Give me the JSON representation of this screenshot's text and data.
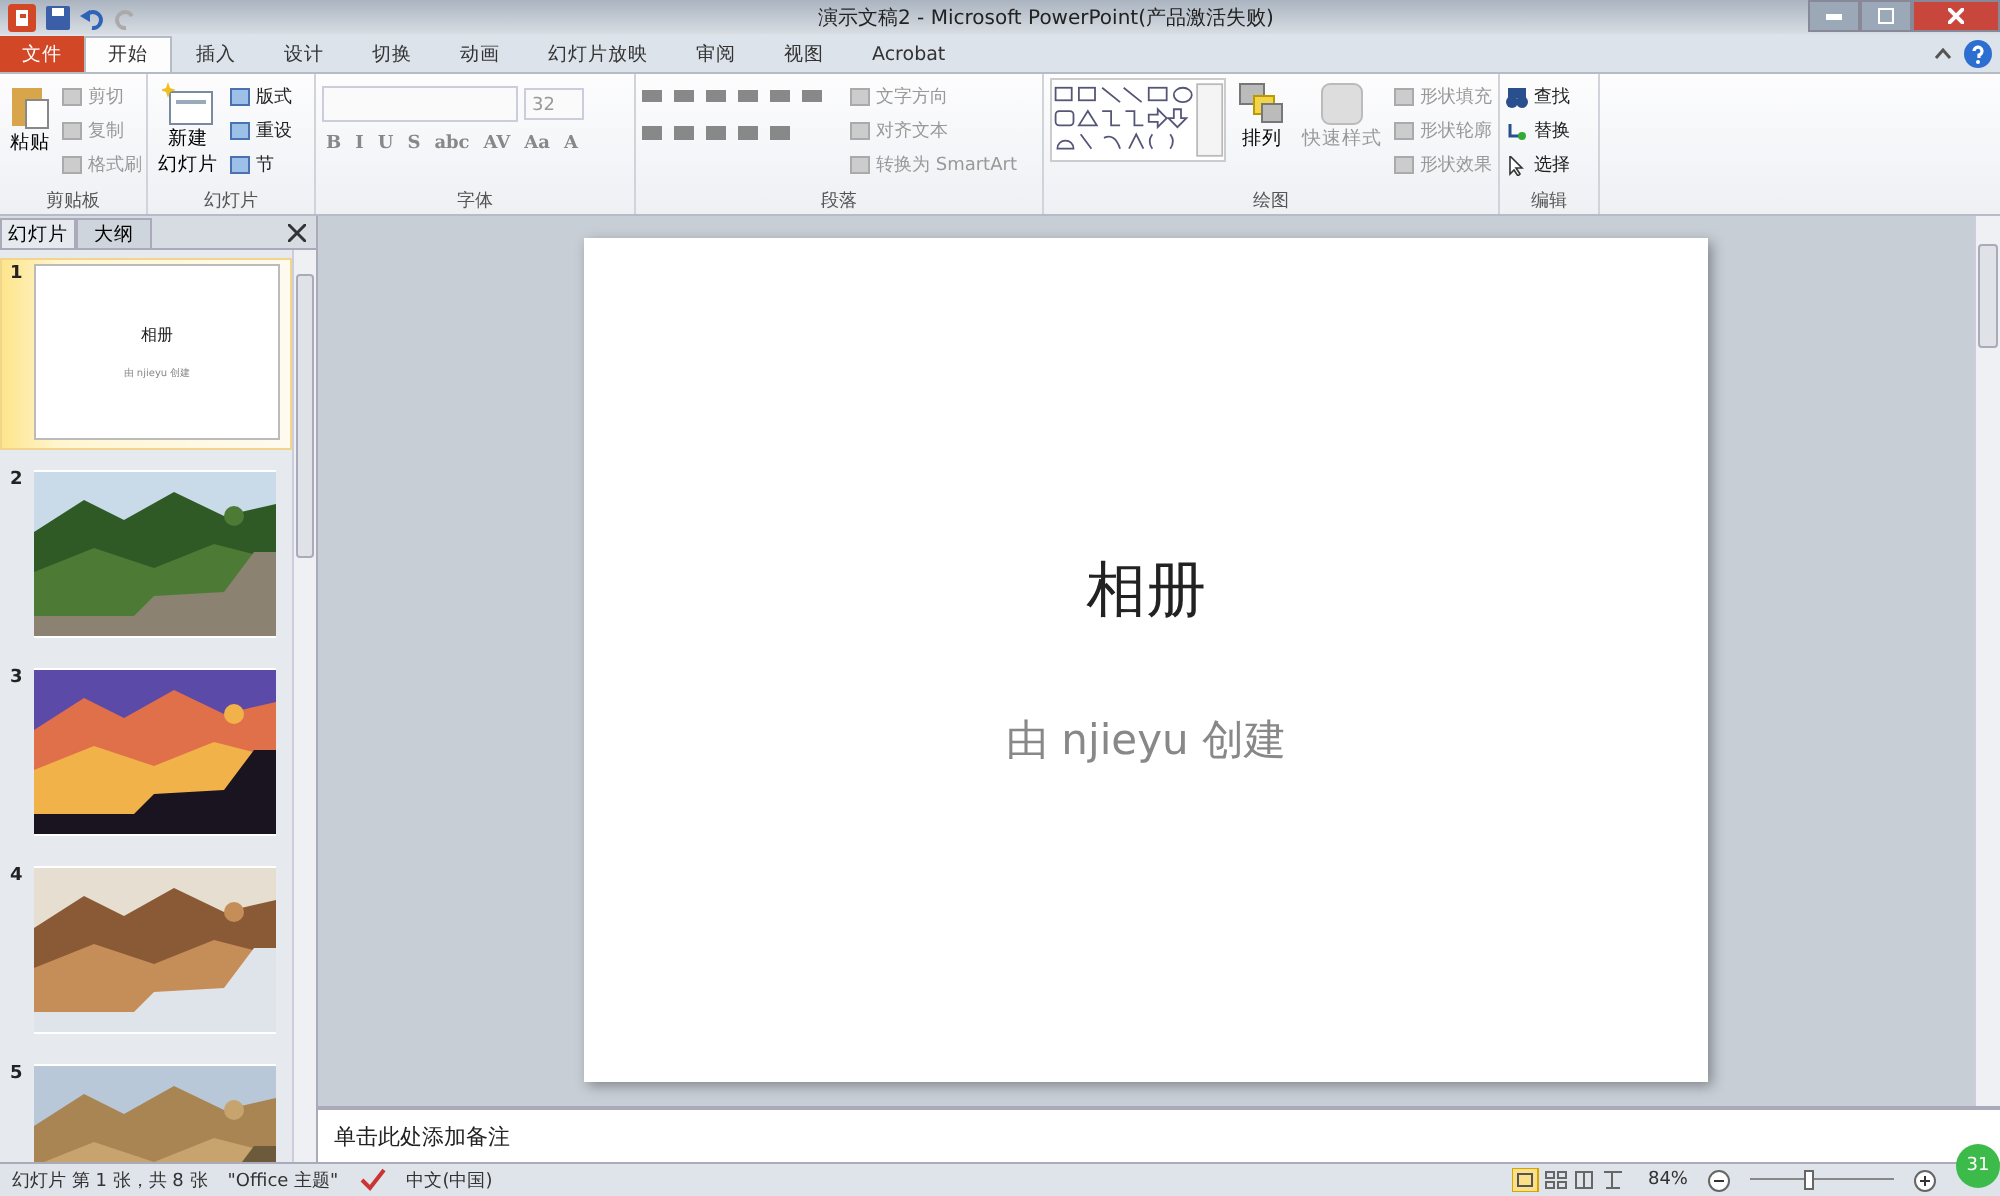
{
  "window": {
    "title": "演示文稿2 - Microsoft PowerPoint(产品激活失败)"
  },
  "tabs": [
    {
      "label": "文件",
      "kind": "file",
      "selected": false
    },
    {
      "label": "开始",
      "kind": "tab",
      "selected": true
    },
    {
      "label": "插入",
      "kind": "tab",
      "selected": false
    },
    {
      "label": "设计",
      "kind": "tab",
      "selected": false
    },
    {
      "label": "切换",
      "kind": "tab",
      "selected": false
    },
    {
      "label": "动画",
      "kind": "tab",
      "selected": false
    },
    {
      "label": "幻灯片放映",
      "kind": "tab",
      "selected": false
    },
    {
      "label": "审阅",
      "kind": "tab",
      "selected": false
    },
    {
      "label": "视图",
      "kind": "tab",
      "selected": false
    },
    {
      "label": "Acrobat",
      "kind": "tab",
      "selected": false
    }
  ],
  "ribbon": {
    "clipboard": {
      "title": "剪贴板",
      "paste": "粘贴",
      "items": [
        {
          "label": "剪切",
          "disabled": true
        },
        {
          "label": "复制",
          "disabled": true
        },
        {
          "label": "格式刷",
          "disabled": true
        }
      ]
    },
    "slides": {
      "title": "幻灯片",
      "new_slide": [
        "新建",
        "幻灯片"
      ],
      "items": [
        {
          "label": "版式",
          "disabled": false
        },
        {
          "label": "重设",
          "disabled": false
        },
        {
          "label": "节",
          "disabled": false
        }
      ]
    },
    "font": {
      "title": "字体",
      "size": "32",
      "buttons": [
        "B",
        "I",
        "U",
        "S",
        "abc",
        "AV",
        "Aa",
        "A"
      ]
    },
    "paragraph": {
      "title": "段落",
      "items": [
        {
          "label": "文字方向",
          "disabled": true
        },
        {
          "label": "对齐文本",
          "disabled": true
        },
        {
          "label": "转换为 SmartArt",
          "disabled": true
        }
      ]
    },
    "drawing": {
      "title": "绘图",
      "arrange": "排列",
      "quick_styles": "快速样式",
      "items": [
        {
          "label": "形状填充",
          "disabled": true
        },
        {
          "label": "形状轮廓",
          "disabled": true
        },
        {
          "label": "形状效果",
          "disabled": true
        }
      ]
    },
    "editing": {
      "title": "编辑",
      "items": [
        {
          "label": "查找",
          "kind": "find"
        },
        {
          "label": "替换",
          "kind": "replace"
        },
        {
          "label": "选择",
          "kind": "select"
        }
      ]
    }
  },
  "pane_tabs": [
    {
      "label": "幻灯片",
      "selected": true
    },
    {
      "label": "大纲",
      "selected": false
    }
  ],
  "thumbnails": [
    {
      "number": "1",
      "kind": "title",
      "selected": true,
      "title": "相册",
      "subtitle": "由 njieyu 创建"
    },
    {
      "number": "2",
      "kind": "picture",
      "selected": false
    },
    {
      "number": "3",
      "kind": "picture",
      "selected": false
    },
    {
      "number": "4",
      "kind": "picture",
      "selected": false
    },
    {
      "number": "5",
      "kind": "picture",
      "selected": false
    }
  ],
  "slide": {
    "title": "相册",
    "subtitle": "由 njieyu 创建"
  },
  "notes": {
    "placeholder": "单击此处添加备注"
  },
  "status_bar": {
    "slide_info": "幻灯片 第 1 张，共 8 张",
    "theme": "\"Office 主题\"",
    "language": "中文(中国)",
    "zoom": "84%",
    "zoom_slider": {
      "level": 0.42
    }
  },
  "badge": "31"
}
